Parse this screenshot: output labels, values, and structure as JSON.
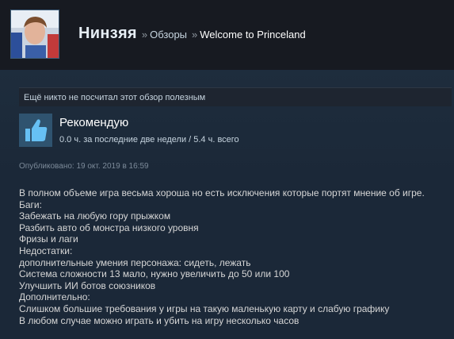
{
  "header": {
    "username": "Нинзяя",
    "separator": "»",
    "breadcrumbs": [
      {
        "label": "Обзоры"
      },
      {
        "label": "Welcome to Princeland"
      }
    ]
  },
  "helpful_text": "Ещё никто не посчитал этот обзор полезным",
  "review": {
    "verdict": "Рекомендую",
    "verdict_icon": "thumbs-up-icon",
    "hours": "0.0 ч. за последние две недели / 5.4 ч. всего",
    "posted": "Опубликовано: 19 окт. 2019 в 16:59",
    "lines": [
      "В полном объеме игра весьма хороша но есть исключения которые портят мнение об игре.",
      "Баги:",
      "Забежать на любую гору прыжком",
      "Разбить авто об монстра низкого уровня",
      "Фризы и лаги",
      "Недостатки:",
      "дополнительные умения персонажа: сидеть, лежать",
      "Система сложности 13 мало, нужно увеличить до 50 или 100",
      "Улучшить ИИ ботов союзников",
      "Дополнительно:",
      "Слишком большие требования у игры на такую маленькую карту и слабую графику",
      "В любом случае можно играть и убить на игру несколько часов"
    ]
  },
  "colors": {
    "background": "#1b2838",
    "header_bg": "#171a21",
    "thumb_bg": "#2f536f",
    "thumb_icon": "#66c0f4"
  }
}
